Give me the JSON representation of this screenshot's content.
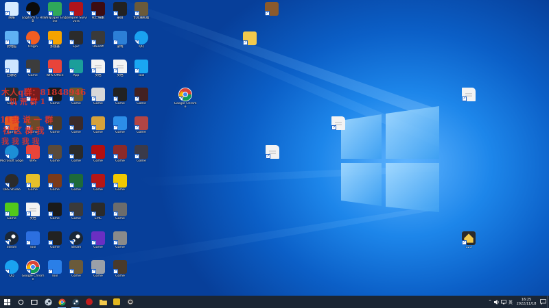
{
  "desktop_icons_left": [
    {
      "label": "网络",
      "icon": "network-icon",
      "color": "#d8ecff"
    },
    {
      "label": "Logitech G HUB",
      "icon": "logitech-ghub-icon",
      "color": "#0b0b0b"
    },
    {
      "label": "Wallpaper Engine",
      "icon": "wallpaper-engine-icon",
      "color": "#2fa85a"
    },
    {
      "label": "Vampire Survivors",
      "icon": "vampire-survivors-icon",
      "color": "#b2141b"
    },
    {
      "label": "死亡细胞",
      "icon": "dead-cells-icon",
      "color": "#3d0c12"
    },
    {
      "label": "录屏",
      "icon": "recorder-icon",
      "color": "#222222"
    },
    {
      "label": "饥荒联机版",
      "icon": "dont-starve-icon",
      "color": "#6a5a3a"
    },
    {
      "label": "此电脑",
      "icon": "this-pc-icon",
      "color": "#5fb1f4"
    },
    {
      "label": "Origin",
      "icon": "origin-icon",
      "color": "#f25d22"
    },
    {
      "label": "加速器",
      "icon": "accelerator-icon",
      "color": "#f5a300"
    },
    {
      "label": "Epic",
      "icon": "epic-icon",
      "color": "#2b2b2b"
    },
    {
      "label": "Ubisoft",
      "icon": "ubisoft-icon",
      "color": "#3a3a3a"
    },
    {
      "label": "游戏",
      "icon": "game-icon",
      "color": "#2c7fd6"
    },
    {
      "label": "QQ",
      "icon": "qq-icon",
      "color": "#1aa2f0"
    },
    {
      "label": "回收站",
      "icon": "recycle-bin-icon",
      "color": "#cfe6ff"
    },
    {
      "label": "Game",
      "icon": "game-icon",
      "color": "#3c3c3c"
    },
    {
      "label": "WPS Office",
      "icon": "wps-icon",
      "color": "#e8443a"
    },
    {
      "label": "App",
      "icon": "app-icon",
      "color": "#1b9e9a"
    },
    {
      "label": "文档",
      "icon": "file-icon",
      "color": "#f3f3f3"
    },
    {
      "label": "文档",
      "icon": "file-icon",
      "color": "#f3f3f3"
    },
    {
      "label": "Tool",
      "icon": "tool-icon",
      "color": "#1aa7f2"
    },
    {
      "label": "Game",
      "icon": "game-icon",
      "color": "#2a2a2a"
    },
    {
      "label": "SE",
      "icon": "se-icon",
      "color": "#7a1b1b"
    },
    {
      "label": "Game",
      "icon": "game-icon",
      "color": "#1a1a1a"
    },
    {
      "label": "Game",
      "icon": "game-icon",
      "color": "#6b5a30"
    },
    {
      "label": "Game",
      "icon": "game-icon",
      "color": "#d8d8d8"
    },
    {
      "label": "Game",
      "icon": "game-icon",
      "color": "#222222"
    },
    {
      "label": "Game",
      "icon": "game-icon",
      "color": "#432121"
    },
    {
      "label": "Game",
      "icon": "game-icon",
      "color": "#e55b1f"
    },
    {
      "label": "Game",
      "icon": "game-icon",
      "color": "#6c4a2a"
    },
    {
      "label": "Game",
      "icon": "game-icon",
      "color": "#4a3a2a"
    },
    {
      "label": "Game",
      "icon": "game-icon",
      "color": "#3a2a2a"
    },
    {
      "label": "Game",
      "icon": "game-icon",
      "color": "#d6a23a"
    },
    {
      "label": "Game",
      "icon": "game-icon",
      "color": "#2c8ee8"
    },
    {
      "label": "Game",
      "icon": "game-icon",
      "color": "#b24545"
    },
    {
      "label": "Microsoft Edge",
      "icon": "edge-icon",
      "color": "#1c8fd6"
    },
    {
      "label": "WPS",
      "icon": "wps-icon",
      "color": "#e8443a"
    },
    {
      "label": "Game",
      "icon": "game-icon",
      "color": "#5a4a3a"
    },
    {
      "label": "Game",
      "icon": "game-icon",
      "color": "#2a2a2a"
    },
    {
      "label": "Game",
      "icon": "game-icon",
      "color": "#b20f0f"
    },
    {
      "label": "Game",
      "icon": "game-icon",
      "color": "#8a2a2a"
    },
    {
      "label": "Game",
      "icon": "game-icon",
      "color": "#3a3a4a"
    },
    {
      "label": "OBS Studio",
      "icon": "obs-icon",
      "color": "#2b2b2b"
    },
    {
      "label": "Game",
      "icon": "game-icon",
      "color": "#e6c02a"
    },
    {
      "label": "Game",
      "icon": "game-icon",
      "color": "#7a3a1a"
    },
    {
      "label": "Game",
      "icon": "game-icon",
      "color": "#1d6a3a"
    },
    {
      "label": "Game",
      "icon": "game-icon",
      "color": "#b51616"
    },
    {
      "label": "Game",
      "icon": "game-icon",
      "color": "#f0c800"
    },
    {
      "label": "",
      "icon": "",
      "color": ""
    },
    {
      "label": "Game",
      "icon": "game-icon",
      "color": "#52c91a"
    },
    {
      "label": "文档",
      "icon": "file-icon",
      "color": "#f3f3f3"
    },
    {
      "label": "Game",
      "icon": "game-icon",
      "color": "#1a1a1a"
    },
    {
      "label": "Game",
      "icon": "game-icon",
      "color": "#3a3a3a"
    },
    {
      "label": "EPIC",
      "icon": "epic-icon",
      "color": "#2b2b2b"
    },
    {
      "label": "Game",
      "icon": "game-icon",
      "color": "#6c6c6c"
    },
    {
      "label": "",
      "icon": "",
      "color": ""
    },
    {
      "label": "Steam",
      "icon": "steam-icon",
      "color": "#1b2838"
    },
    {
      "label": "Tool",
      "icon": "tool-icon",
      "color": "#2c6fe0"
    },
    {
      "label": "Game",
      "icon": "game-icon",
      "color": "#222222"
    },
    {
      "label": "Steam",
      "icon": "steam-icon",
      "color": "#1b2838"
    },
    {
      "label": "Game",
      "icon": "game-icon",
      "color": "#6a2fc2"
    },
    {
      "label": "Game",
      "icon": "game-icon",
      "color": "#8a8a8a"
    },
    {
      "label": "",
      "icon": "",
      "color": ""
    },
    {
      "label": "QQ",
      "icon": "qq-icon",
      "color": "#1aa2f0"
    },
    {
      "label": "Google Chrome",
      "icon": "chrome-icon",
      "color": "#ffffff"
    },
    {
      "label": "Tool",
      "icon": "tool-icon",
      "color": "#2a7fe8"
    },
    {
      "label": "Game",
      "icon": "game-icon",
      "color": "#6a5a3a"
    },
    {
      "label": "Game",
      "icon": "game-icon",
      "color": "#9aa0a8"
    },
    {
      "label": "Game",
      "icon": "game-icon",
      "color": "#4a3a2a"
    },
    {
      "label": "",
      "icon": "",
      "color": ""
    }
  ],
  "desktop_icons_floating": [
    {
      "label": "",
      "icon": "winrar-icon",
      "color": "#8b5a2b"
    },
    {
      "label": "",
      "icon": "folder-icon",
      "color": "#f2c94c"
    },
    {
      "label": "Google Chrome",
      "icon": "chrome-icon",
      "color": "#ffffff"
    },
    {
      "label": "",
      "icon": "file-icon",
      "color": "#f3f3f3"
    },
    {
      "label": "",
      "icon": "file-icon",
      "color": "#f3f3f3"
    },
    {
      "label": "",
      "icon": "file-icon",
      "color": "#f3f3f3"
    },
    {
      "label": "123",
      "icon": "home-icon",
      "color": "#f2c94c"
    }
  ],
  "watermark": {
    "line1": "木人q群：81848946",
    "line2": "饥 荒 群 1",
    "line3": "11我 说 一 群",
    "line4": "社 区 群 我",
    "line5": "我 我 我 我"
  },
  "taskbar": {
    "pinned": [
      {
        "name": "start-button",
        "icon": "windows-logo-icon"
      },
      {
        "name": "search-button",
        "icon": "search-icon"
      },
      {
        "name": "task-view-button",
        "icon": "task-view-icon"
      },
      {
        "name": "taskbar-steam",
        "icon": "steam-icon"
      },
      {
        "name": "taskbar-chrome",
        "icon": "chrome-icon"
      },
      {
        "name": "taskbar-steam-2",
        "icon": "steam-icon"
      },
      {
        "name": "taskbar-app-red",
        "icon": "app-icon"
      },
      {
        "name": "taskbar-file-explorer",
        "icon": "folder-icon"
      },
      {
        "name": "taskbar-app-yellow",
        "icon": "app-icon"
      },
      {
        "name": "taskbar-app-gear",
        "icon": "gear-icon"
      }
    ],
    "ime": "英",
    "time": "16:25",
    "date": "2022/11/18",
    "accent": "#8fc3ff"
  }
}
